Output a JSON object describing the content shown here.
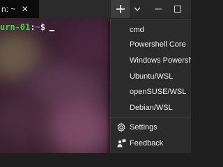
{
  "tab": {
    "title": "n: ~",
    "close_glyph": "✕"
  },
  "titlebar": {
    "new_tab_glyph": "+",
    "dropdown_glyph": "⌄",
    "new_tab_icon": "plus-icon",
    "dropdown_icon": "chevron-down-icon"
  },
  "terminal": {
    "host": "urn-01",
    "separator": ":",
    "path": "~",
    "dollar": "$",
    "colors": {
      "host": "#3fd24a",
      "background": "#3a2030"
    }
  },
  "menu": {
    "profiles": [
      "cmd",
      "Powershell Core",
      "Windows Powershell",
      "Ubuntu/WSL",
      "openSUSE/WSL",
      "Debian/WSL"
    ],
    "settings_label": "Settings",
    "feedback_label": "Feedback",
    "settings_icon": "gear-icon",
    "feedback_icon": "feedback-icon"
  }
}
